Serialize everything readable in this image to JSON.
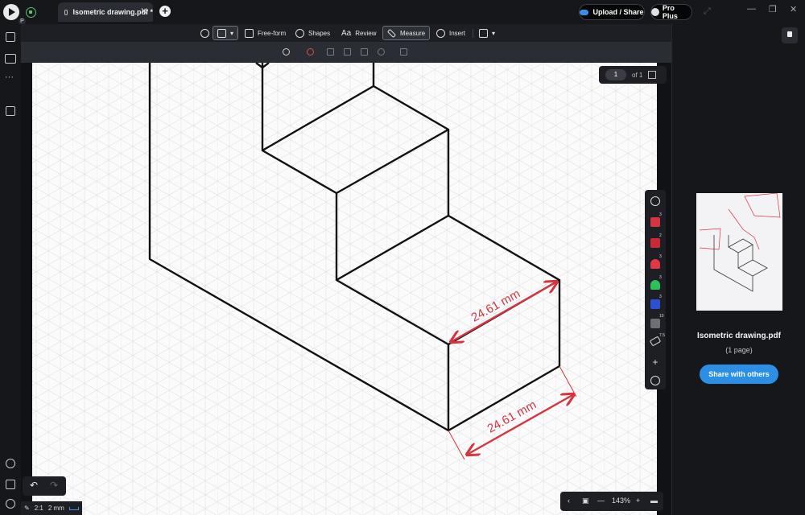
{
  "tab": {
    "title": "Isometric drawing.pdf *"
  },
  "titlebar": {
    "upload_label": "Upload / Share",
    "pro_label": "Pro Plus"
  },
  "left_rail": {
    "badge": "P",
    "more": "···"
  },
  "toolbar": {
    "freeform": "Free-form",
    "shapes": "Shapes",
    "review": "Review",
    "measure": "Measure",
    "insert": "Insert",
    "review_glyph": "Aa"
  },
  "page_indicator": {
    "current": "1",
    "of": "of 1"
  },
  "drawing": {
    "dimension_top": "24.61 mm",
    "dimension_bottom": "24.61 mm",
    "line_color": "#111111",
    "dimension_color": "#d6343f"
  },
  "vtools": {
    "badges": [
      "3",
      "2",
      "3",
      "3",
      "3",
      "10",
      "7.5"
    ]
  },
  "bottom_left": {
    "ratio": "2:1",
    "unit": "2 mm"
  },
  "zoom": {
    "level": "143%"
  },
  "right_panel": {
    "file_name": "Isometric drawing.pdf",
    "pages": "(1 page)",
    "share_label": "Share with others"
  },
  "colors": {
    "accent": "#2b8fe6",
    "background": "#15171b",
    "dimension": "#d6343f"
  }
}
